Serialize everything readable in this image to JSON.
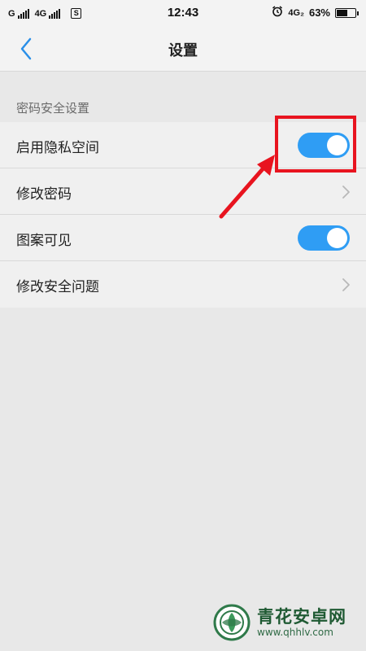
{
  "status_bar": {
    "network_1": "G",
    "network_2": "4G",
    "sim_label": "S",
    "time": "12:43",
    "network_3": "4G₂",
    "battery_percent_text": "63%",
    "battery_level": 0.63
  },
  "header": {
    "title": "设置",
    "back_icon": "chevron-left-icon"
  },
  "section": {
    "header": "密码安全设置",
    "items": [
      {
        "label": "启用隐私空间",
        "control": "toggle",
        "state": "on"
      },
      {
        "label": "修改密码",
        "control": "chevron"
      },
      {
        "label": "图案可见",
        "control": "toggle",
        "state": "on"
      },
      {
        "label": "修改安全问题",
        "control": "chevron"
      }
    ]
  },
  "watermark": {
    "title": "青花安卓网",
    "url": "www.qhhlv.com"
  },
  "colors": {
    "accent": "#2f9df4",
    "annotation": "#e8141f",
    "background": "#e8e8e8"
  }
}
